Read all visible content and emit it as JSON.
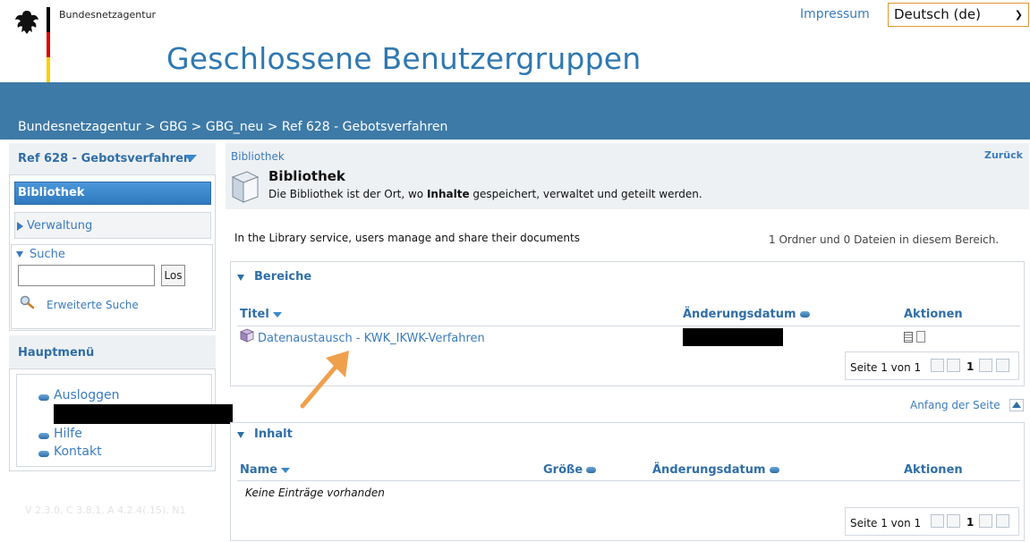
{
  "header": {
    "org_name": "Bundesnetzagentur",
    "impressum": "Impressum",
    "language_selected": "Deutsch (de)",
    "site_title": "Geschlossene Benutzergruppen",
    "breadcrumb": "Bundesnetzagentur > GBG  > GBG_neu > Ref 628 - Gebotsverfahren",
    "flag_colors": [
      "#000000",
      "#dd0000",
      "#ffce00"
    ]
  },
  "sidebar": {
    "section_title": "Ref 628 - Gebotsverfahren",
    "nav_active": "Bibliothek",
    "nav_item2": "Verwaltung",
    "search_label": "Suche",
    "search_placeholder": "",
    "search_button": "Los",
    "advanced_search": "Erweiterte Suche",
    "main_menu_title": "Hauptmenü",
    "menu_items": [
      "Ausloggen",
      "Hilfe",
      "Kontakt"
    ],
    "version": "V 2.3.0, C 3.8.1, A 4.2.4(.15), N1"
  },
  "main": {
    "breadcrumb": "Bibliothek",
    "back": "Zurück",
    "title": "Bibliothek",
    "desc_pre": "Die Bibliothek ist der Ort, wo ",
    "desc_bold": "Inhalte",
    "desc_post": " gespeichert, verwaltet und geteilt werden.",
    "service_text": "In the Library service, users manage and share their documents",
    "count_text": "1 Ordner und 0 Dateien in diesem Bereich.",
    "areas": {
      "title": "Bereiche",
      "col_title": "Titel",
      "col_date": "Änderungsdatum",
      "col_actions": "Aktionen",
      "row_link": "Datenaustausch - KWK_IKWK-Verfahren"
    },
    "pager": {
      "text": "Seite 1 von 1",
      "page": "1"
    },
    "top_link": "Anfang der Seite",
    "content": {
      "title": "Inhalt",
      "col_name": "Name",
      "col_size": "Größe",
      "col_date": "Änderungsdatum",
      "col_actions": "Aktionen",
      "empty": "Keine Einträge vorhanden"
    }
  },
  "annotation": {
    "arrow_color": "#f0a04b"
  }
}
